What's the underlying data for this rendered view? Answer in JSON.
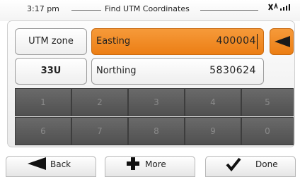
{
  "status": {
    "time": "3:17 pm",
    "title": "Find UTM Coordinates"
  },
  "fields": {
    "utm_zone_label": "UTM zone",
    "utm_zone_value": "33U",
    "easting_label": "Easting",
    "easting_value": "400004",
    "northing_label": "Northing",
    "northing_value": "5830624"
  },
  "keypad": [
    "1",
    "2",
    "3",
    "4",
    "5",
    "6",
    "7",
    "8",
    "9",
    "0"
  ],
  "buttons": {
    "back": "Back",
    "more": "More",
    "done": "Done"
  },
  "colors": {
    "accent": "#f08a24",
    "key": "#5c5c5c"
  }
}
